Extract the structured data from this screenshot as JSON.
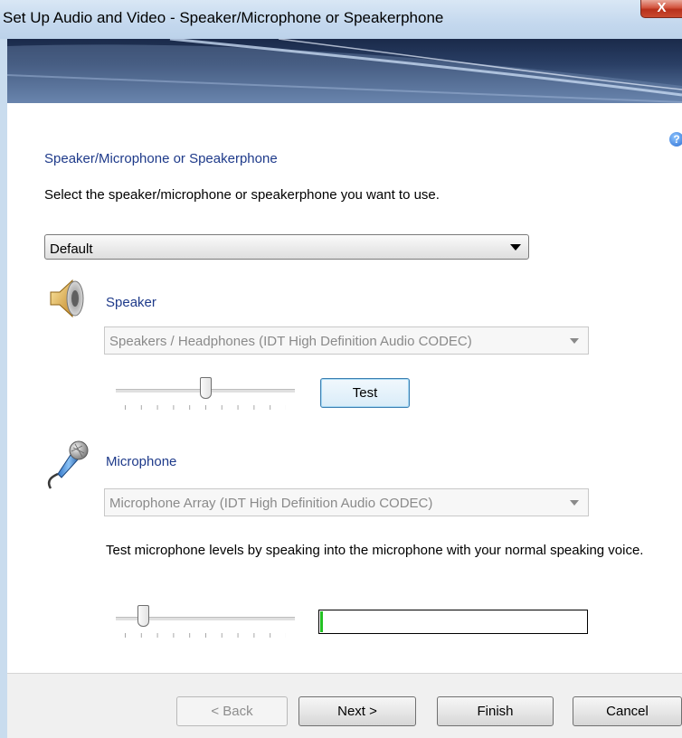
{
  "window": {
    "title": "Set Up Audio and Video - Speaker/Microphone or Speakerphone",
    "close_glyph": "X"
  },
  "page": {
    "section_title": "Speaker/Microphone or Speakerphone",
    "instruction": "Select the speaker/microphone or speakerphone you want to use.",
    "device_select": {
      "selected": "Default"
    },
    "help_glyph": "?"
  },
  "speaker": {
    "label": "Speaker",
    "device": "Speakers / Headphones (IDT High Definition Audio CODEC)",
    "volume_fraction": 0.5,
    "test_label": "Test",
    "icon": "speaker-icon"
  },
  "microphone": {
    "label": "Microphone",
    "device": "Microphone Array (IDT High Definition Audio CODEC)",
    "instruction": "Test microphone levels by speaking into the microphone with your normal speaking voice.",
    "volume_fraction": 0.13,
    "level_fraction": 0.01,
    "icon": "microphone-icon"
  },
  "footer": {
    "back_label": "< Back",
    "next_label": "Next >",
    "finish_label": "Finish",
    "cancel_label": "Cancel"
  },
  "colors": {
    "section_title": "#1e3a8a",
    "level_meter": "#22c022"
  }
}
